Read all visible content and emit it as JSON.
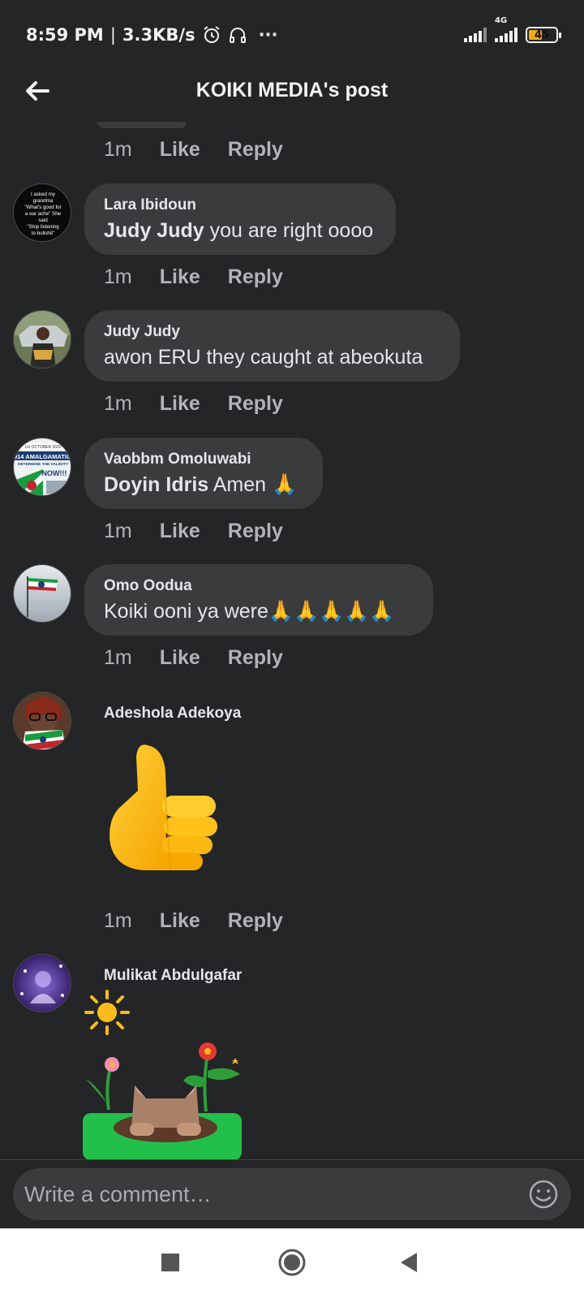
{
  "status_bar": {
    "time": "8:59 PM",
    "separator": "|",
    "speed": "3.3KB/s",
    "more": "···",
    "network": "4G",
    "battery": "45"
  },
  "header": {
    "title": "KOIKI MEDIA's post"
  },
  "top_actions": {
    "time": "1m",
    "like": "Like",
    "reply": "Reply"
  },
  "comments": [
    {
      "author": "Lara Ibidoun",
      "mention": "Judy Judy",
      "text": " you are right oooo",
      "avatar_text": "I asked my grandma \"What's good for a ear ache\" She said \"Stop listening to bullshit\"",
      "time": "1m",
      "like": "Like",
      "reply": "Reply"
    },
    {
      "author": "Judy Judy",
      "mention": "",
      "text": "awon  ERU they caught at abeokuta",
      "time": "1m",
      "like": "Like",
      "reply": "Reply"
    },
    {
      "author": "Vaobbm Omoluwabi",
      "mention": "Doyin Idris",
      "text": " Amen 🙏",
      "avatar_text_top": "1st OCTOBER 2020",
      "avatar_text_mid": "1914 AMALGAMATION",
      "avatar_text_sub": "DETERMINE THE VALIDITY",
      "avatar_text_now": "NOW!!!",
      "time": "1m",
      "like": "Like",
      "reply": "Reply"
    },
    {
      "author": "Omo Oodua",
      "mention": "",
      "text": "Koiki ooni ya were🙏🙏🙏🙏🙏",
      "time": "1m",
      "like": "Like",
      "reply": "Reply"
    },
    {
      "author": "Adeshola Adekoya",
      "sticker": "thumbs-up",
      "time": "1m",
      "like": "Like",
      "reply": "Reply"
    },
    {
      "author": "Mulikat Abdulgafar",
      "sticker": "sun-flowers-cat"
    }
  ],
  "composer": {
    "placeholder": "Write a comment…"
  },
  "colors": {
    "background": "#242526",
    "bubble": "#3a3b3c",
    "muted": "#b0b3b8",
    "battery": "#f0a81c"
  }
}
